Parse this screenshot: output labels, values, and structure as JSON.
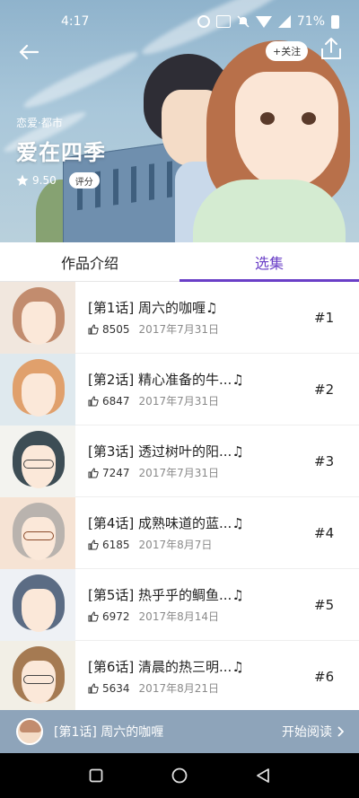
{
  "status_bar": {
    "time": "4:17",
    "battery": "71%"
  },
  "header": {
    "follow_label": "+关注",
    "genre": "恋爱·都市",
    "title": "爱在四季",
    "rating": "9.50",
    "rate_label": "评分"
  },
  "tabs": [
    {
      "label": "作品介绍",
      "active": false
    },
    {
      "label": "选集",
      "active": true
    }
  ],
  "episodes": [
    {
      "title": "[第1话] 周六的咖喱♫",
      "likes": "8505",
      "date": "2017年7月31日",
      "number": "#1"
    },
    {
      "title": "[第2话] 精心准备的牛...♫",
      "likes": "6847",
      "date": "2017年7月31日",
      "number": "#2"
    },
    {
      "title": "[第3话] 透过树叶的阳...♫",
      "likes": "7247",
      "date": "2017年7月31日",
      "number": "#3"
    },
    {
      "title": "[第4话] 成熟味道的蓝...♫",
      "likes": "6185",
      "date": "2017年8月7日",
      "number": "#4"
    },
    {
      "title": "[第5话] 热乎乎的鲷鱼...♫",
      "likes": "6972",
      "date": "2017年8月14日",
      "number": "#5"
    },
    {
      "title": "[第6话] 清晨的热三明...♫",
      "likes": "5634",
      "date": "2017年8月21日",
      "number": "#6"
    }
  ],
  "continue_bar": {
    "episode": "[第1话] 周六的咖喱",
    "action": "开始阅读"
  },
  "colors": {
    "accent": "#6a3fc7",
    "continue_bar": "#8ea4ba"
  }
}
